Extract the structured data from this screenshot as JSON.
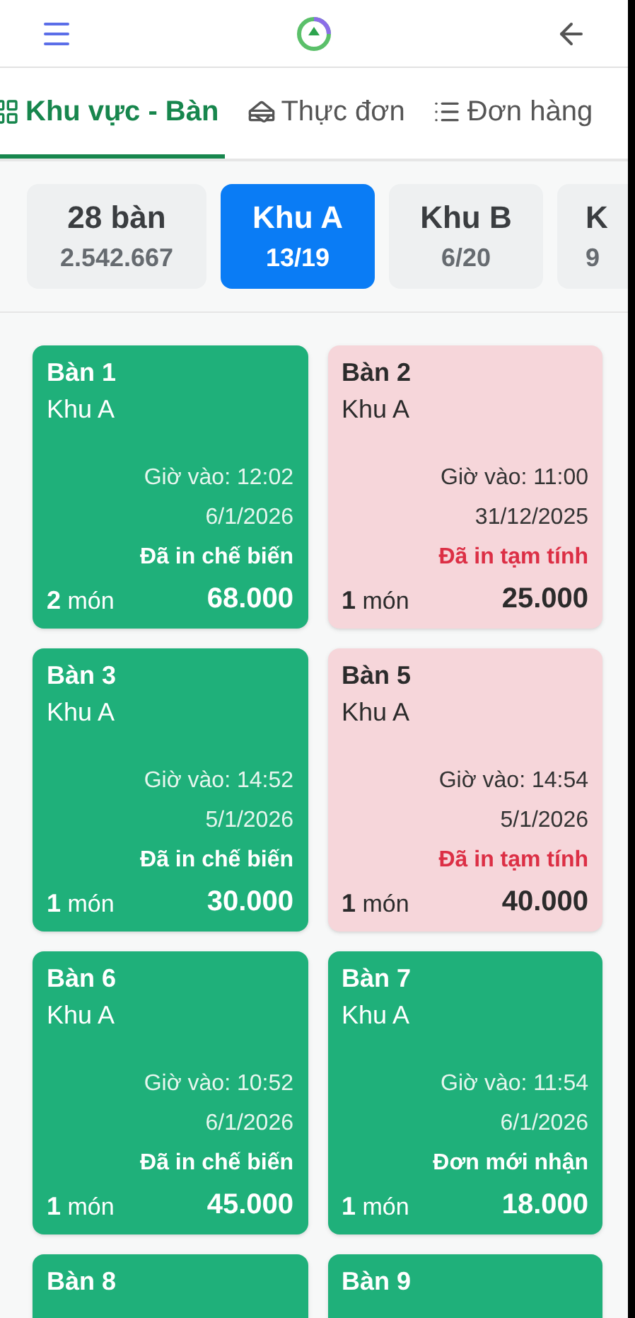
{
  "tabs": [
    {
      "label": "Khu vực - Bàn",
      "selected": true
    },
    {
      "label": "Thực đơn",
      "selected": false
    },
    {
      "label": "Đơn hàng",
      "selected": false
    }
  ],
  "areas": [
    {
      "title": "28 bàn",
      "subtitle": "2.542.667",
      "selected": false
    },
    {
      "title": "Khu A",
      "subtitle": "13/19",
      "selected": true
    },
    {
      "title": "Khu B",
      "subtitle": "6/20",
      "selected": false
    },
    {
      "title": "K",
      "subtitle": "9",
      "selected": false
    }
  ],
  "tables": [
    {
      "name": "Bàn 1",
      "area": "Khu A",
      "time": "Giờ vào: 12:02",
      "date": "6/1/2026",
      "status": "Đã in chế biến",
      "kind": "cooking",
      "count": "2",
      "unit": "món",
      "total": "68.000"
    },
    {
      "name": "Bàn 2",
      "area": "Khu A",
      "time": "Giờ vào: 11:00",
      "date": "31/12/2025",
      "status": "Đã in tạm tính",
      "kind": "bill",
      "count": "1",
      "unit": "món",
      "total": "25.000"
    },
    {
      "name": "Bàn 3",
      "area": "Khu A",
      "time": "Giờ vào: 14:52",
      "date": "5/1/2026",
      "status": "Đã in chế biến",
      "kind": "cooking",
      "count": "1",
      "unit": "món",
      "total": "30.000"
    },
    {
      "name": "Bàn 5",
      "area": "Khu A",
      "time": "Giờ vào: 14:54",
      "date": "5/1/2026",
      "status": "Đã in tạm tính",
      "kind": "bill",
      "count": "1",
      "unit": "món",
      "total": "40.000"
    },
    {
      "name": "Bàn 6",
      "area": "Khu A",
      "time": "Giờ vào: 10:52",
      "date": "6/1/2026",
      "status": "Đã in chế biến",
      "kind": "cooking",
      "count": "1",
      "unit": "món",
      "total": "45.000"
    },
    {
      "name": "Bàn 7",
      "area": "Khu A",
      "time": "Giờ vào: 11:54",
      "date": "6/1/2026",
      "status": "Đơn mới nhận",
      "kind": "new",
      "count": "1",
      "unit": "món",
      "total": "18.000"
    },
    {
      "name": "Bàn 8",
      "kind": "cooking"
    },
    {
      "name": "Bàn 9",
      "kind": "new"
    }
  ]
}
